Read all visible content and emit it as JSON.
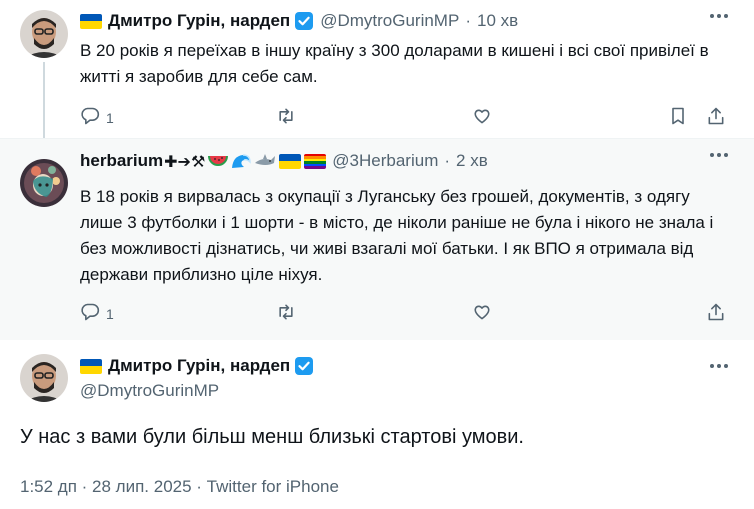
{
  "colors": {
    "text_primary": "#0f1419",
    "text_secondary": "#536471",
    "verified_blue": "#1d9bf0",
    "highlight_bg": "#f7f9f9"
  },
  "tweets": [
    {
      "name": "Дмитро Гурін, нардеп",
      "handle": "@DmytroGurinMP",
      "separator": "·",
      "time": "10 хв",
      "text": "В 20 років я переїхав в іншу країну з 300 доларами в кишені і всі свої привілеї в житті я заробив для себе сам.",
      "reply_count": "1",
      "icons": [
        "ukraine-flag",
        "verified-badge",
        "reply-icon",
        "retweet-icon",
        "like-icon",
        "bookmark-icon",
        "share-icon"
      ]
    },
    {
      "name": "herbarium",
      "name_emoji": "✚➔⚒",
      "handle": "@3Herbarium",
      "separator": "·",
      "time": "2 хв",
      "text": "В 18 років я вирвалась з окупації з Луганську без грошей, документів, з одягу лише 3 футболки і 1 шорти - в місто, де ніколи раніше не була і нікого не знала і без можливості дізнатись, чи живі взагалі мої батьки. І як ВПО я отримала від держави приблизно ціле ніхуя.",
      "reply_count": "1",
      "icons": [
        "watermelon-icon",
        "wave-icon",
        "shark-icon",
        "ukraine-flag",
        "rainbow-flag"
      ]
    }
  ],
  "main_tweet": {
    "name": "Дмитро Гурін, нардеп",
    "handle": "@DmytroGurinMP",
    "text": "У нас з вами були більш менш близькі стартові умови.",
    "meta": "1:52 дп · 28 лип. 2025 · Twitter for iPhone"
  }
}
